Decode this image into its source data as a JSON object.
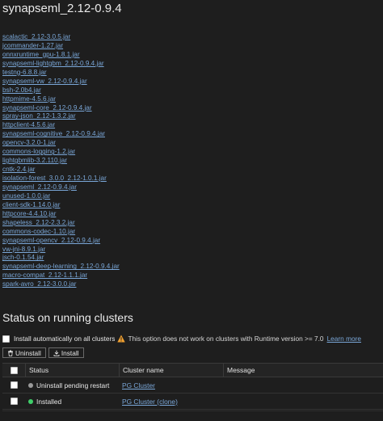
{
  "page": {
    "title": "synapseml_2.12-0.9.4"
  },
  "jars": [
    "scalactic_2.12-3.0.5.jar",
    "jcommander-1.27.jar",
    "onnxruntime_gpu-1.8.1.jar",
    "synapseml-lightgbm_2.12-0.9.4.jar",
    "testng-6.8.8.jar",
    "synapseml-vw_2.12-0.9.4.jar",
    "bsh-2.0b4.jar",
    "httpmime-4.5.6.jar",
    "synapseml-core_2.12-0.9.4.jar",
    "spray-json_2.12-1.3.2.jar",
    "httpclient-4.5.6.jar",
    "synapseml-cognitive_2.12-0.9.4.jar",
    "opencv-3.2.0-1.jar",
    "commons-logging-1.2.jar",
    "lightgbmlib-3.2.110.jar",
    "cntk-2.4.jar",
    "isolation-forest_3.0.0_2.12-1.0.1.jar",
    "synapseml_2.12-0.9.4.jar",
    "unused-1.0.0.jar",
    "client-sdk-1.14.0.jar",
    "httpcore-4.4.10.jar",
    "shapeless_2.12-2.3.2.jar",
    "commons-codec-1.10.jar",
    "synapseml-opencv_2.12-0.9.4.jar",
    "vw-jni-8.9.1.jar",
    "jsch-0.1.54.jar",
    "synapseml-deep-learning_2.12-0.9.4.jar",
    "macro-compat_2.12-1.1.1.jar",
    "spark-avro_2.12-3.0.0.jar"
  ],
  "clusters_section": {
    "title": "Status on running clusters",
    "auto_install_label": "Install automatically on all clusters",
    "warning_icon": "warning-triangle-icon",
    "warning_note": "This option does not work on clusters with Runtime version >= 7.0",
    "learn_more": "Learn more",
    "uninstall_button": "Uninstall",
    "install_button": "Install"
  },
  "table": {
    "headers": {
      "status": "Status",
      "cluster": "Cluster name",
      "message": "Message"
    },
    "rows": [
      {
        "status": "Uninstall pending restart",
        "status_color": "#9a9a9a",
        "cluster": "PG Cluster",
        "message": ""
      },
      {
        "status": "Installed",
        "status_color": "#3fcf6a",
        "cluster": "PG Cluster (clone)",
        "message": ""
      }
    ]
  },
  "colors": {
    "background": "#1e1e1e",
    "link": "#7aa7d8",
    "warning": "#f0a030"
  }
}
